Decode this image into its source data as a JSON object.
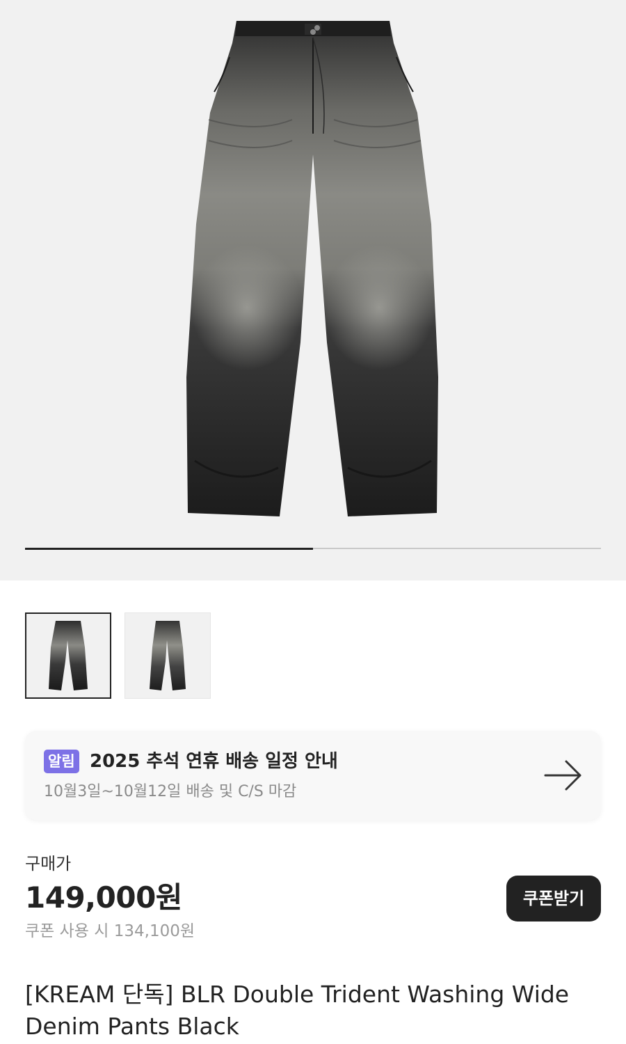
{
  "gallery": {
    "main_image_icon": "wide-denim-pants-image",
    "current_index": 1,
    "total": 2,
    "progress_fraction": 0.5
  },
  "thumbnails": [
    {
      "icon": "jeans-thumbnail-front",
      "selected": true
    },
    {
      "icon": "jeans-thumbnail-alt",
      "selected": false
    }
  ],
  "notice": {
    "badge": "알림",
    "title": "2025 추석 연휴 배송 일정 안내",
    "subtitle": "10월3일~10월12일 배송 및 C/S 마감",
    "arrow_icon": "arrow-right-icon"
  },
  "pricing": {
    "label": "구매가",
    "price": "149,000원",
    "coupon_price": "쿠폰 사용 시 134,100원",
    "coupon_button": "쿠폰받기"
  },
  "product": {
    "title": "[KREAM 단독] BLR Double Trident Washing Wide Denim Pants Black"
  },
  "colors": {
    "badge": "#7d71e6",
    "button": "#222222",
    "hero_bg": "#f1f1f1"
  }
}
